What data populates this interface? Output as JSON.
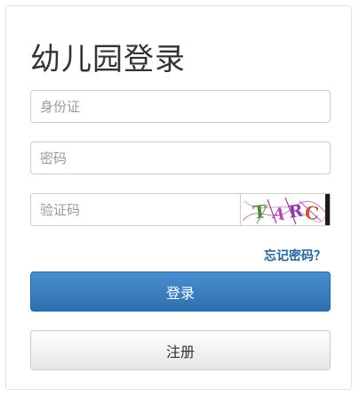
{
  "login": {
    "title": "幼儿园登录",
    "id_placeholder": "身份证",
    "password_placeholder": "密码",
    "captcha_placeholder": "验证码",
    "captcha_text": "T A R C",
    "forgot_label": "忘记密码？",
    "login_label": "登录",
    "register_label": "注册"
  },
  "colors": {
    "primary": "#337ab7",
    "link": "#2a6496"
  }
}
